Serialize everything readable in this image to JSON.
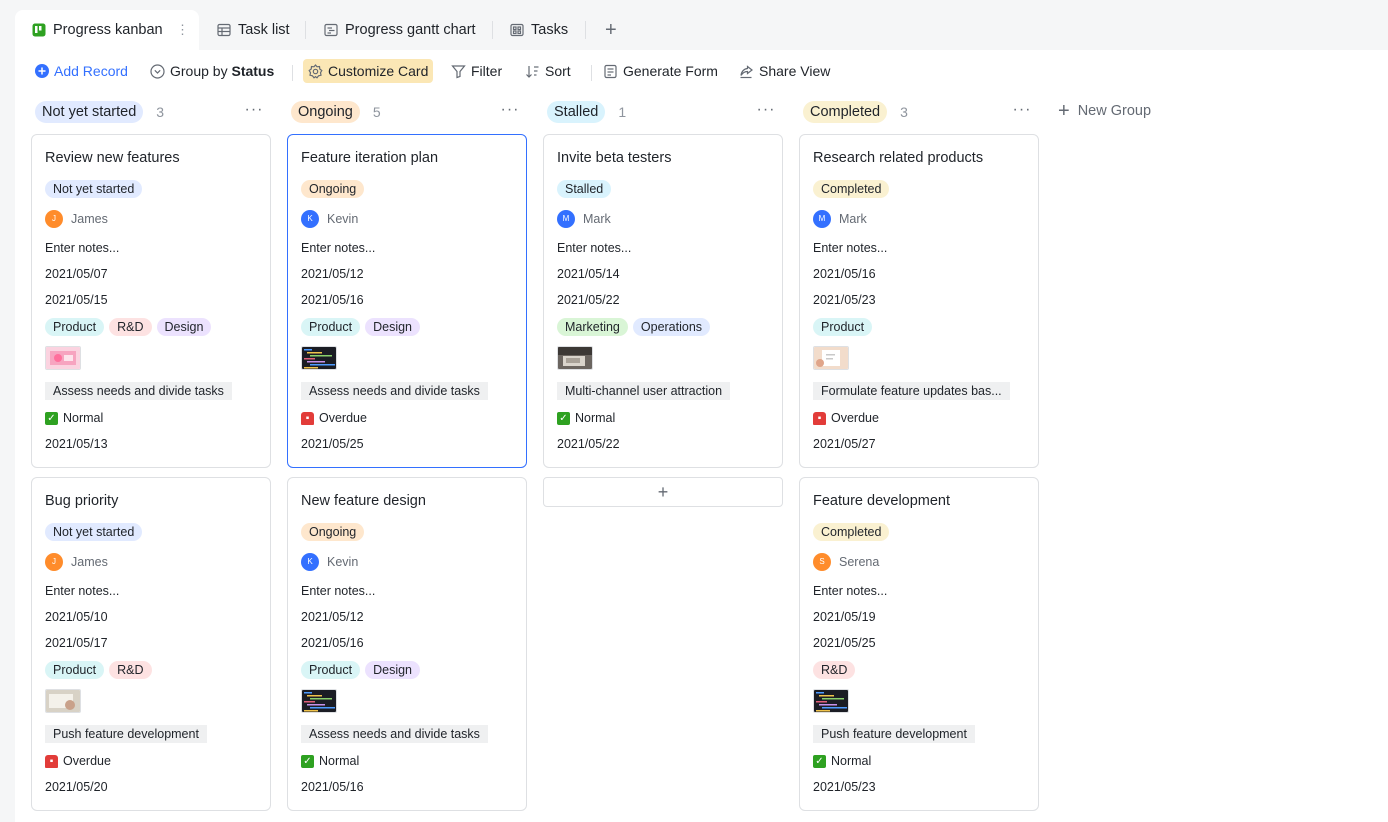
{
  "tabs": [
    {
      "label": "Progress kanban",
      "icon": "kanban-icon"
    },
    {
      "label": "Task list",
      "icon": "grid-table-icon"
    },
    {
      "label": "Progress gantt chart",
      "icon": "gantt-icon"
    },
    {
      "label": "Tasks",
      "icon": "gallery-icon"
    }
  ],
  "toolbar": {
    "add_record": "Add Record",
    "group_by_prefix": "Group by",
    "group_by_field": "Status",
    "customize_card": "Customize Card",
    "filter": "Filter",
    "sort": "Sort",
    "generate_form": "Generate Form",
    "share_view": "Share View"
  },
  "columns": [
    {
      "status": "Not yet started",
      "count": "3",
      "color": "#e1eaff"
    },
    {
      "status": "Ongoing",
      "count": "5",
      "color": "#fee7cd"
    },
    {
      "status": "Stalled",
      "count": "1",
      "color": "#d9f3fd"
    },
    {
      "status": "Completed",
      "count": "3",
      "color": "#faf1d1"
    }
  ],
  "new_group": "New Group",
  "tag_colors": {
    "Product": "#d9f5f6",
    "R&D": "#fde2e2",
    "Design": "#ece2fe",
    "Marketing": "#d9f5d6",
    "Operations": "#e1eaff"
  },
  "cards": [
    {
      "title": "Review new features",
      "status": "Not yet started",
      "person": "James",
      "avatar_color": "#ff8c2b",
      "notes": "Enter notes...",
      "start": "2021/05/07",
      "end": "2021/05/15",
      "tags": [
        "Product",
        "R&D",
        "Design"
      ],
      "thumb": "pink",
      "link": "Assess needs and divide tasks",
      "health": "Normal",
      "health_icon": "check-icon",
      "due": "2021/05/13"
    },
    {
      "title": "Feature iteration plan",
      "status": "Ongoing",
      "person": "Kevin",
      "avatar_color": "#3370ff",
      "notes": "Enter notes...",
      "start": "2021/05/12",
      "end": "2021/05/16",
      "tags": [
        "Product",
        "Design"
      ],
      "thumb": "code",
      "link": "Assess needs and divide tasks",
      "health": "Overdue",
      "health_icon": "siren-icon",
      "due": "2021/05/25"
    },
    {
      "title": "Invite beta testers",
      "status": "Stalled",
      "person": "Mark",
      "avatar_color": "#3370ff",
      "notes": "Enter notes...",
      "start": "2021/05/14",
      "end": "2021/05/22",
      "tags": [
        "Marketing",
        "Operations"
      ],
      "thumb": "desk",
      "link": "Multi-channel user attraction",
      "health": "Normal",
      "health_icon": "check-icon",
      "due": "2021/05/22"
    },
    {
      "title": "Research related products",
      "status": "Completed",
      "person": "Mark",
      "avatar_color": "#3370ff",
      "notes": "Enter notes...",
      "start": "2021/05/16",
      "end": "2021/05/23",
      "tags": [
        "Product"
      ],
      "thumb": "paper",
      "link": "Formulate feature updates bas...",
      "health": "Overdue",
      "health_icon": "siren-icon",
      "due": "2021/05/27"
    },
    {
      "title": "Bug priority",
      "status": "Not yet started",
      "person": "James",
      "avatar_color": "#ff8c2b",
      "notes": "Enter notes...",
      "start": "2021/05/10",
      "end": "2021/05/17",
      "tags": [
        "Product",
        "R&D"
      ],
      "thumb": "hand",
      "link": "Push feature development",
      "health": "Overdue",
      "health_icon": "siren-icon",
      "due": "2021/05/20"
    },
    {
      "title": "New feature design",
      "status": "Ongoing",
      "person": "Kevin",
      "avatar_color": "#3370ff",
      "notes": "Enter notes...",
      "start": "2021/05/12",
      "end": "2021/05/16",
      "tags": [
        "Product",
        "Design"
      ],
      "thumb": "code",
      "link": "Assess needs and divide tasks",
      "health": "Normal",
      "health_icon": "check-icon",
      "due": "2021/05/16"
    },
    {
      "title": "Feature development",
      "status": "Completed",
      "person": "Serena",
      "avatar_color": "#ff8c2b",
      "notes": "Enter notes...",
      "start": "2021/05/19",
      "end": "2021/05/25",
      "tags": [
        "R&D"
      ],
      "thumb": "code",
      "link": "Push feature development",
      "health": "Normal",
      "health_icon": "check-icon",
      "due": "2021/05/23"
    }
  ]
}
